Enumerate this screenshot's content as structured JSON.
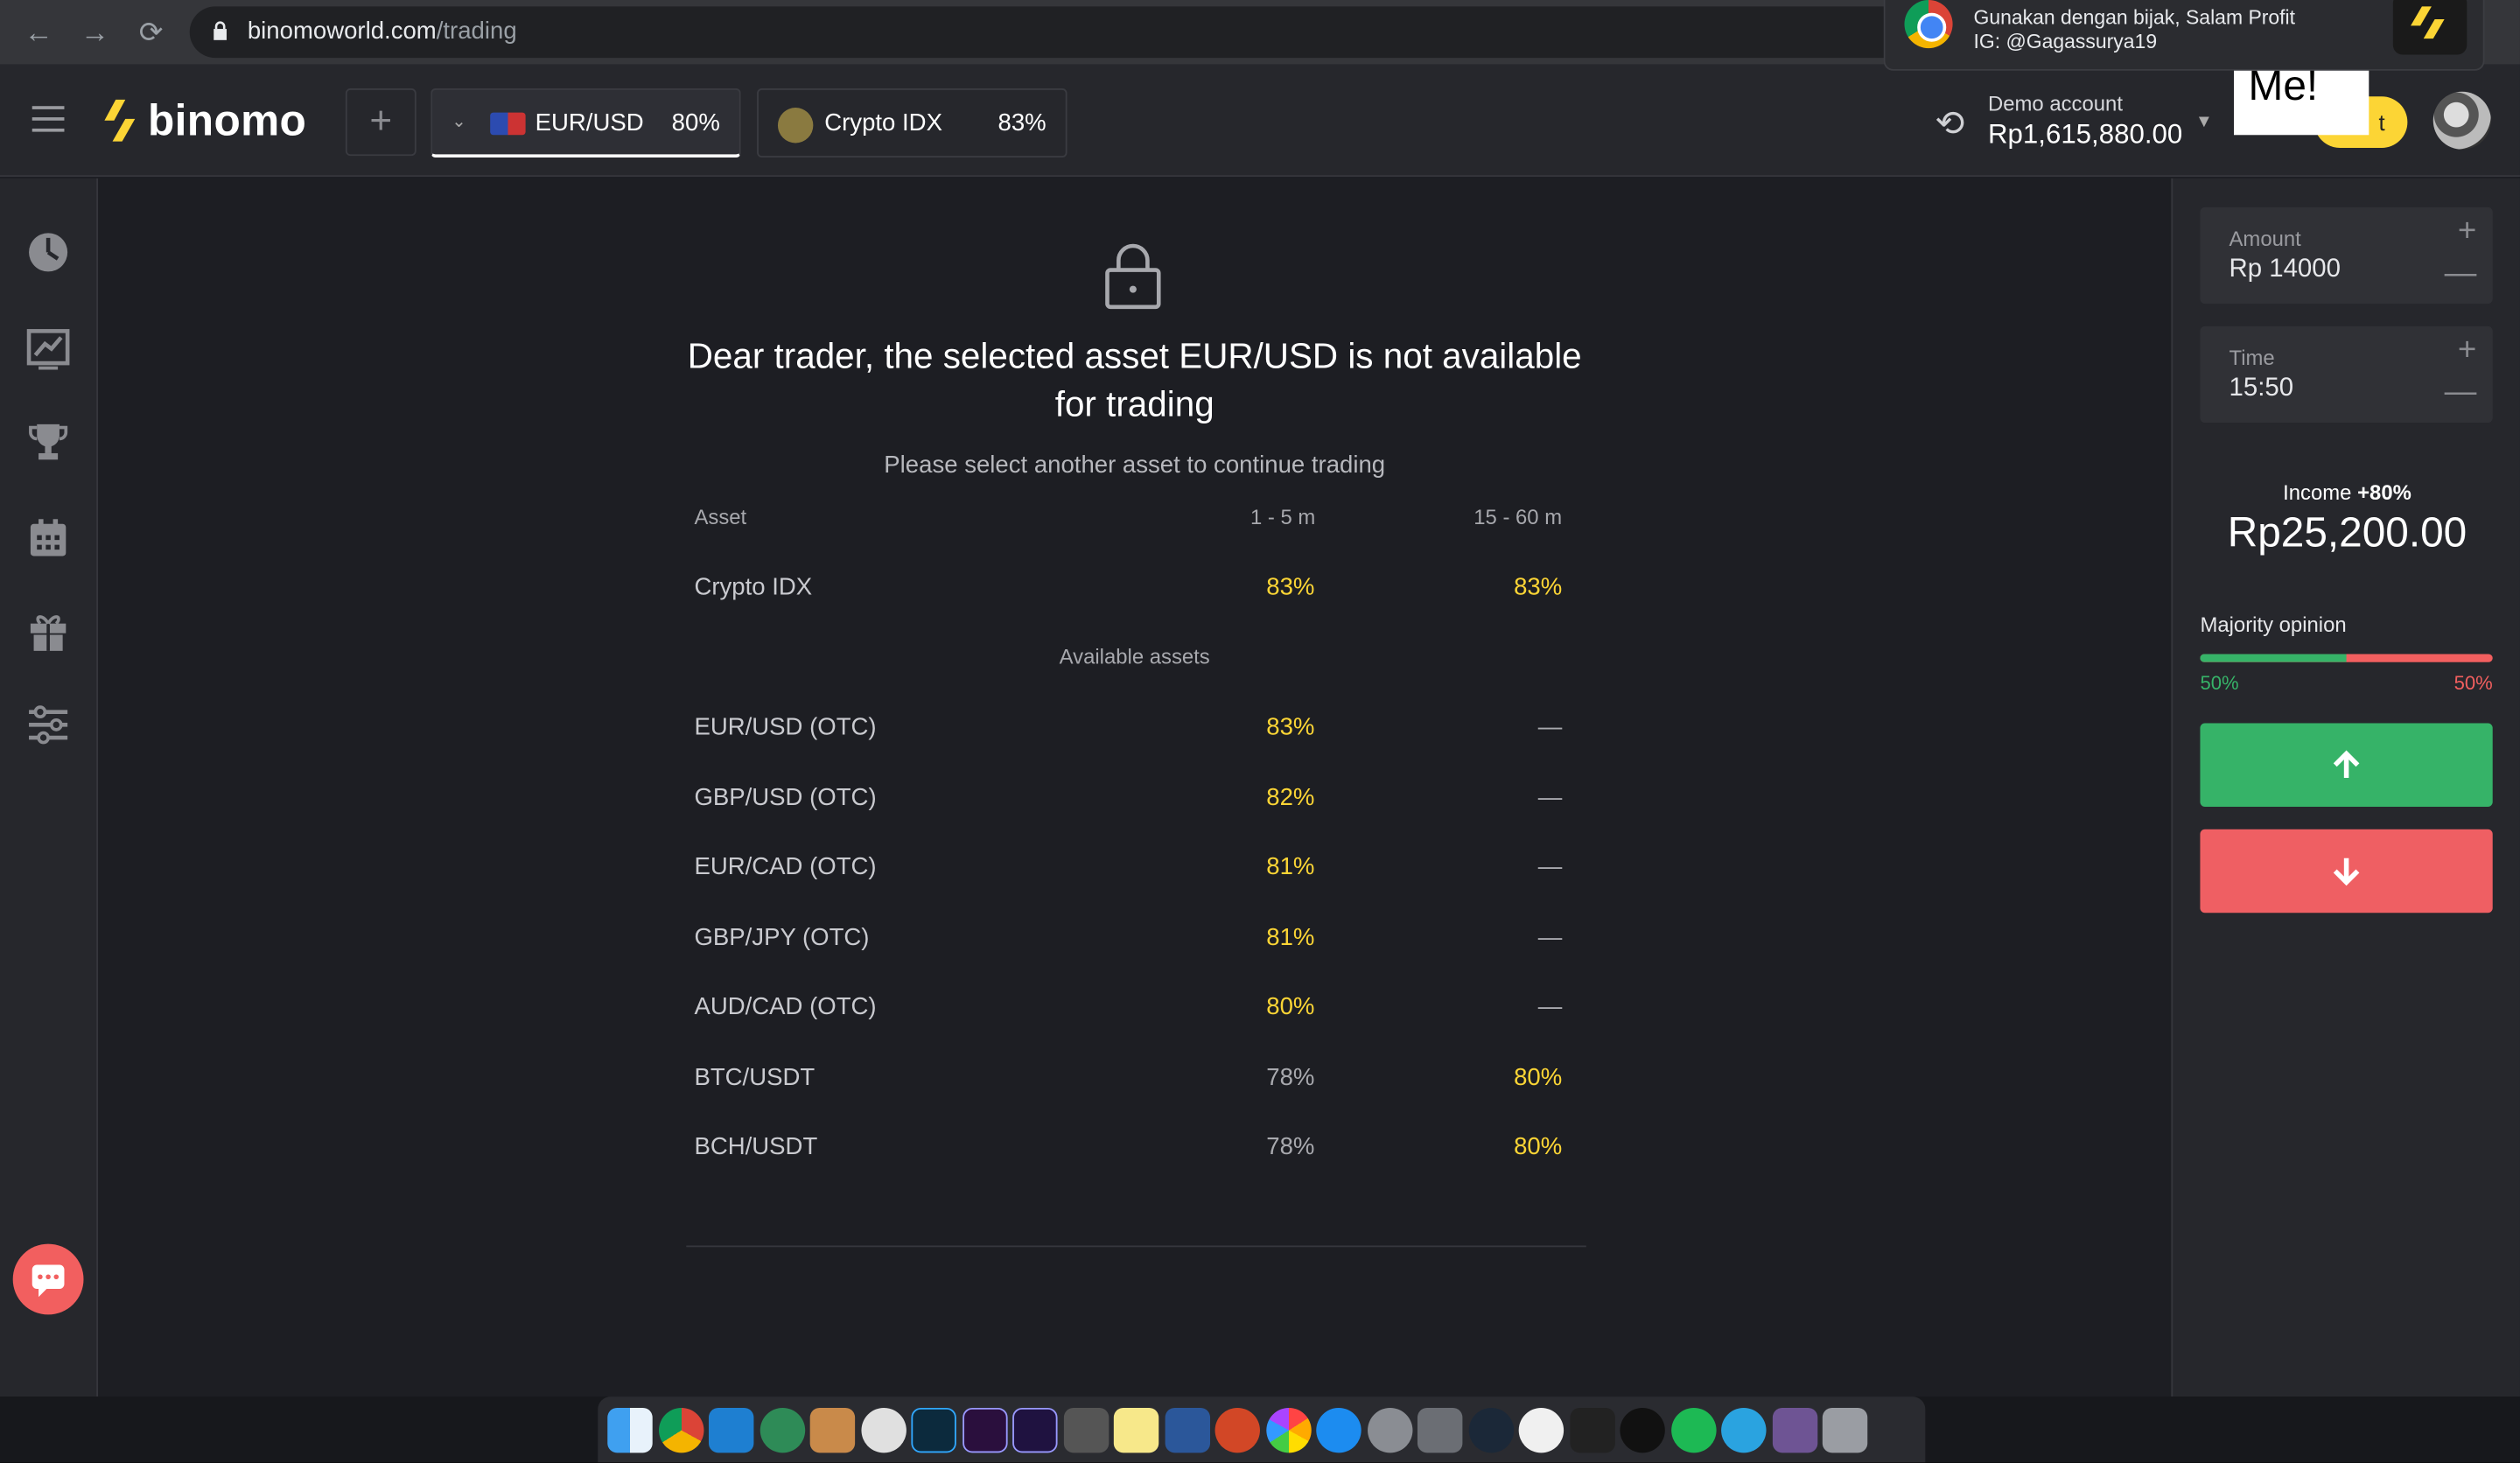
{
  "browser": {
    "url_domain": "binomoworld.com",
    "url_path": "/trading"
  },
  "notification": {
    "line1": "Gunakan dengan bijak, Salam Profit",
    "line2": "IG: @Gagassurya19"
  },
  "header": {
    "logo": "binomo",
    "plus": "+",
    "tabs": [
      {
        "label": "EUR/USD",
        "percent": "80%"
      },
      {
        "label": "Crypto IDX",
        "percent": "83%"
      }
    ],
    "account_label": "Demo account",
    "balance": "Rp1,615,880.00",
    "deposit_partial": "t",
    "hover_text": "Hover Me!"
  },
  "main": {
    "message": "Dear trader, the selected asset EUR/USD is not available for trading",
    "sub": "Please select another asset to continue trading",
    "col_asset": "Asset",
    "col_short": "1 - 5 m",
    "col_long": "15 - 60 m",
    "top_row": {
      "name": "Crypto IDX",
      "p1": "83%",
      "p2": "83%"
    },
    "available_label": "Available assets",
    "assets": [
      {
        "name": "EUR/USD (OTC)",
        "p1": "83%",
        "p2": "—"
      },
      {
        "name": "GBP/USD (OTC)",
        "p1": "82%",
        "p2": "—"
      },
      {
        "name": "EUR/CAD (OTC)",
        "p1": "81%",
        "p2": "—"
      },
      {
        "name": "GBP/JPY (OTC)",
        "p1": "81%",
        "p2": "—"
      },
      {
        "name": "AUD/CAD (OTC)",
        "p1": "80%",
        "p2": "—"
      },
      {
        "name": "BTC/USDT",
        "p1": "78%",
        "p2": "80%"
      },
      {
        "name": "BCH/USDT",
        "p1": "78%",
        "p2": "80%"
      }
    ]
  },
  "panel": {
    "amount_label": "Amount",
    "amount_value": "Rp 14000",
    "time_label": "Time",
    "time_value": "15:50",
    "income_label": "Income",
    "income_pct": "+80%",
    "income_value": "Rp25,200.00",
    "majority_label": "Majority opinion",
    "majority_up": "50%",
    "majority_down": "50%",
    "majority_up_fraction": 0.5
  },
  "colors": {
    "accent_yellow": "#fcd535",
    "up_green": "#36b368",
    "down_red": "#ef5f63"
  }
}
